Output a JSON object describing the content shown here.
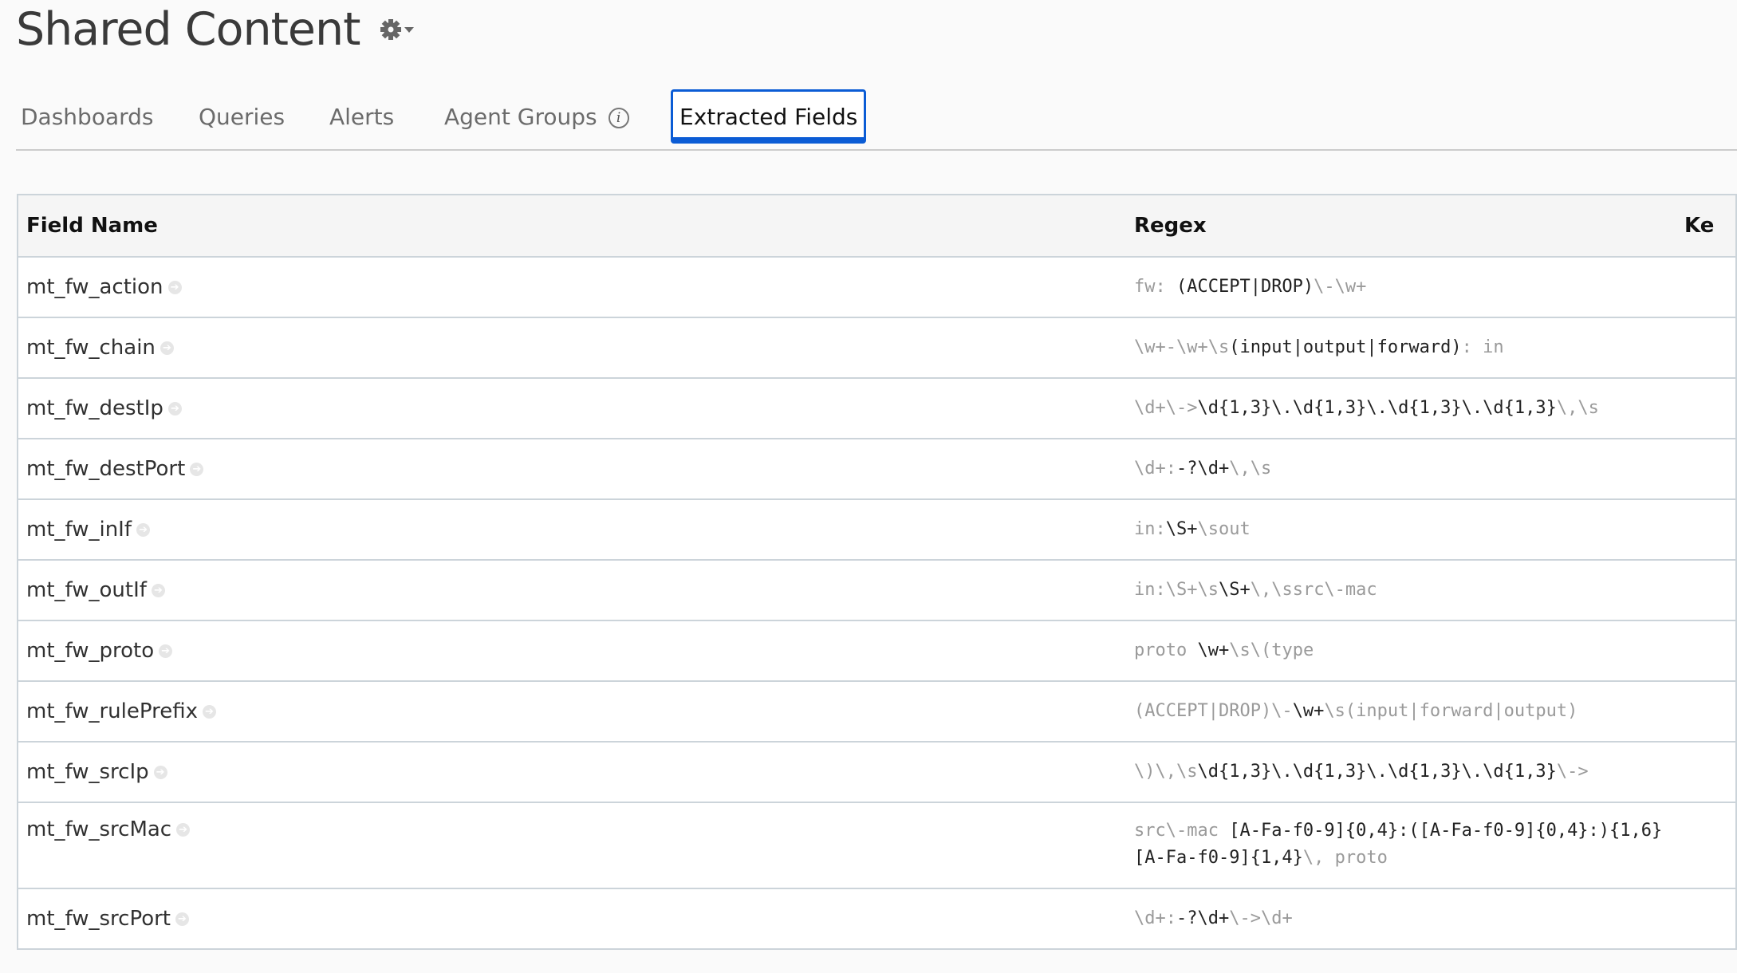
{
  "header": {
    "title": "Shared Content",
    "settings_icon": "gear-icon"
  },
  "tabs": [
    {
      "label": "Dashboards",
      "active": false
    },
    {
      "label": "Queries",
      "active": false
    },
    {
      "label": "Alerts",
      "active": false
    },
    {
      "label": "Agent Groups",
      "active": false,
      "icon": "info-icon"
    },
    {
      "label": "Extracted Fields",
      "active": true
    }
  ],
  "colors": {
    "accent": "#0b5cd5",
    "regex_dim": "#9a9a9a",
    "regex_match": "#222222"
  },
  "table": {
    "columns": [
      "Field Name",
      "Regex",
      "Ke"
    ],
    "rows": [
      {
        "name": "mt_fw_action",
        "regex": [
          [
            "d",
            "fw: "
          ],
          [
            "b",
            "(ACCEPT|DROP)"
          ],
          [
            "d",
            "\\-\\w+"
          ]
        ]
      },
      {
        "name": "mt_fw_chain",
        "regex": [
          [
            "d",
            "\\w+-\\w+\\s"
          ],
          [
            "b",
            "(input|output|forward)"
          ],
          [
            "d",
            ": in"
          ]
        ]
      },
      {
        "name": "mt_fw_destIp",
        "regex": [
          [
            "d",
            "\\d+\\->"
          ],
          [
            "b",
            "\\d{1,3}\\.\\d{1,3}\\.\\d{1,3}\\.\\d{1,3}"
          ],
          [
            "d",
            "\\,\\s"
          ]
        ]
      },
      {
        "name": "mt_fw_destPort",
        "regex": [
          [
            "d",
            "\\d+:"
          ],
          [
            "b",
            "-?\\d+"
          ],
          [
            "d",
            "\\,\\s"
          ]
        ]
      },
      {
        "name": "mt_fw_inIf",
        "regex": [
          [
            "d",
            "in:"
          ],
          [
            "b",
            "\\S+"
          ],
          [
            "d",
            "\\sout"
          ]
        ]
      },
      {
        "name": "mt_fw_outIf",
        "regex": [
          [
            "d",
            "in:\\S+\\s"
          ],
          [
            "b",
            "\\S+"
          ],
          [
            "d",
            "\\,\\ssrc\\-mac"
          ]
        ]
      },
      {
        "name": "mt_fw_proto",
        "regex": [
          [
            "d",
            "proto "
          ],
          [
            "b",
            "\\w+"
          ],
          [
            "d",
            "\\s\\(type"
          ]
        ]
      },
      {
        "name": "mt_fw_rulePrefix",
        "regex": [
          [
            "d",
            "(ACCEPT|DROP)\\-"
          ],
          [
            "b",
            "\\w+"
          ],
          [
            "d",
            "\\s(input|forward|output)"
          ]
        ]
      },
      {
        "name": "mt_fw_srcIp",
        "regex": [
          [
            "d",
            "\\)\\,\\s"
          ],
          [
            "b",
            "\\d{1,3}\\.\\d{1,3}\\.\\d{1,3}\\.\\d{1,3}"
          ],
          [
            "d",
            "\\->"
          ]
        ]
      },
      {
        "name": "mt_fw_srcMac",
        "regex": [
          [
            "d",
            "src\\-mac "
          ],
          [
            "b",
            "[A-Fa-f0-9]{0,4}:([A-Fa-f0-9]{0,4}:){1,6}[A-Fa-f0-9]{1,4}"
          ],
          [
            "d",
            "\\, proto"
          ]
        ]
      },
      {
        "name": "mt_fw_srcPort",
        "regex": [
          [
            "d",
            "\\d+:"
          ],
          [
            "b",
            "-?\\d+"
          ],
          [
            "d",
            "\\->\\d+"
          ]
        ]
      }
    ]
  }
}
